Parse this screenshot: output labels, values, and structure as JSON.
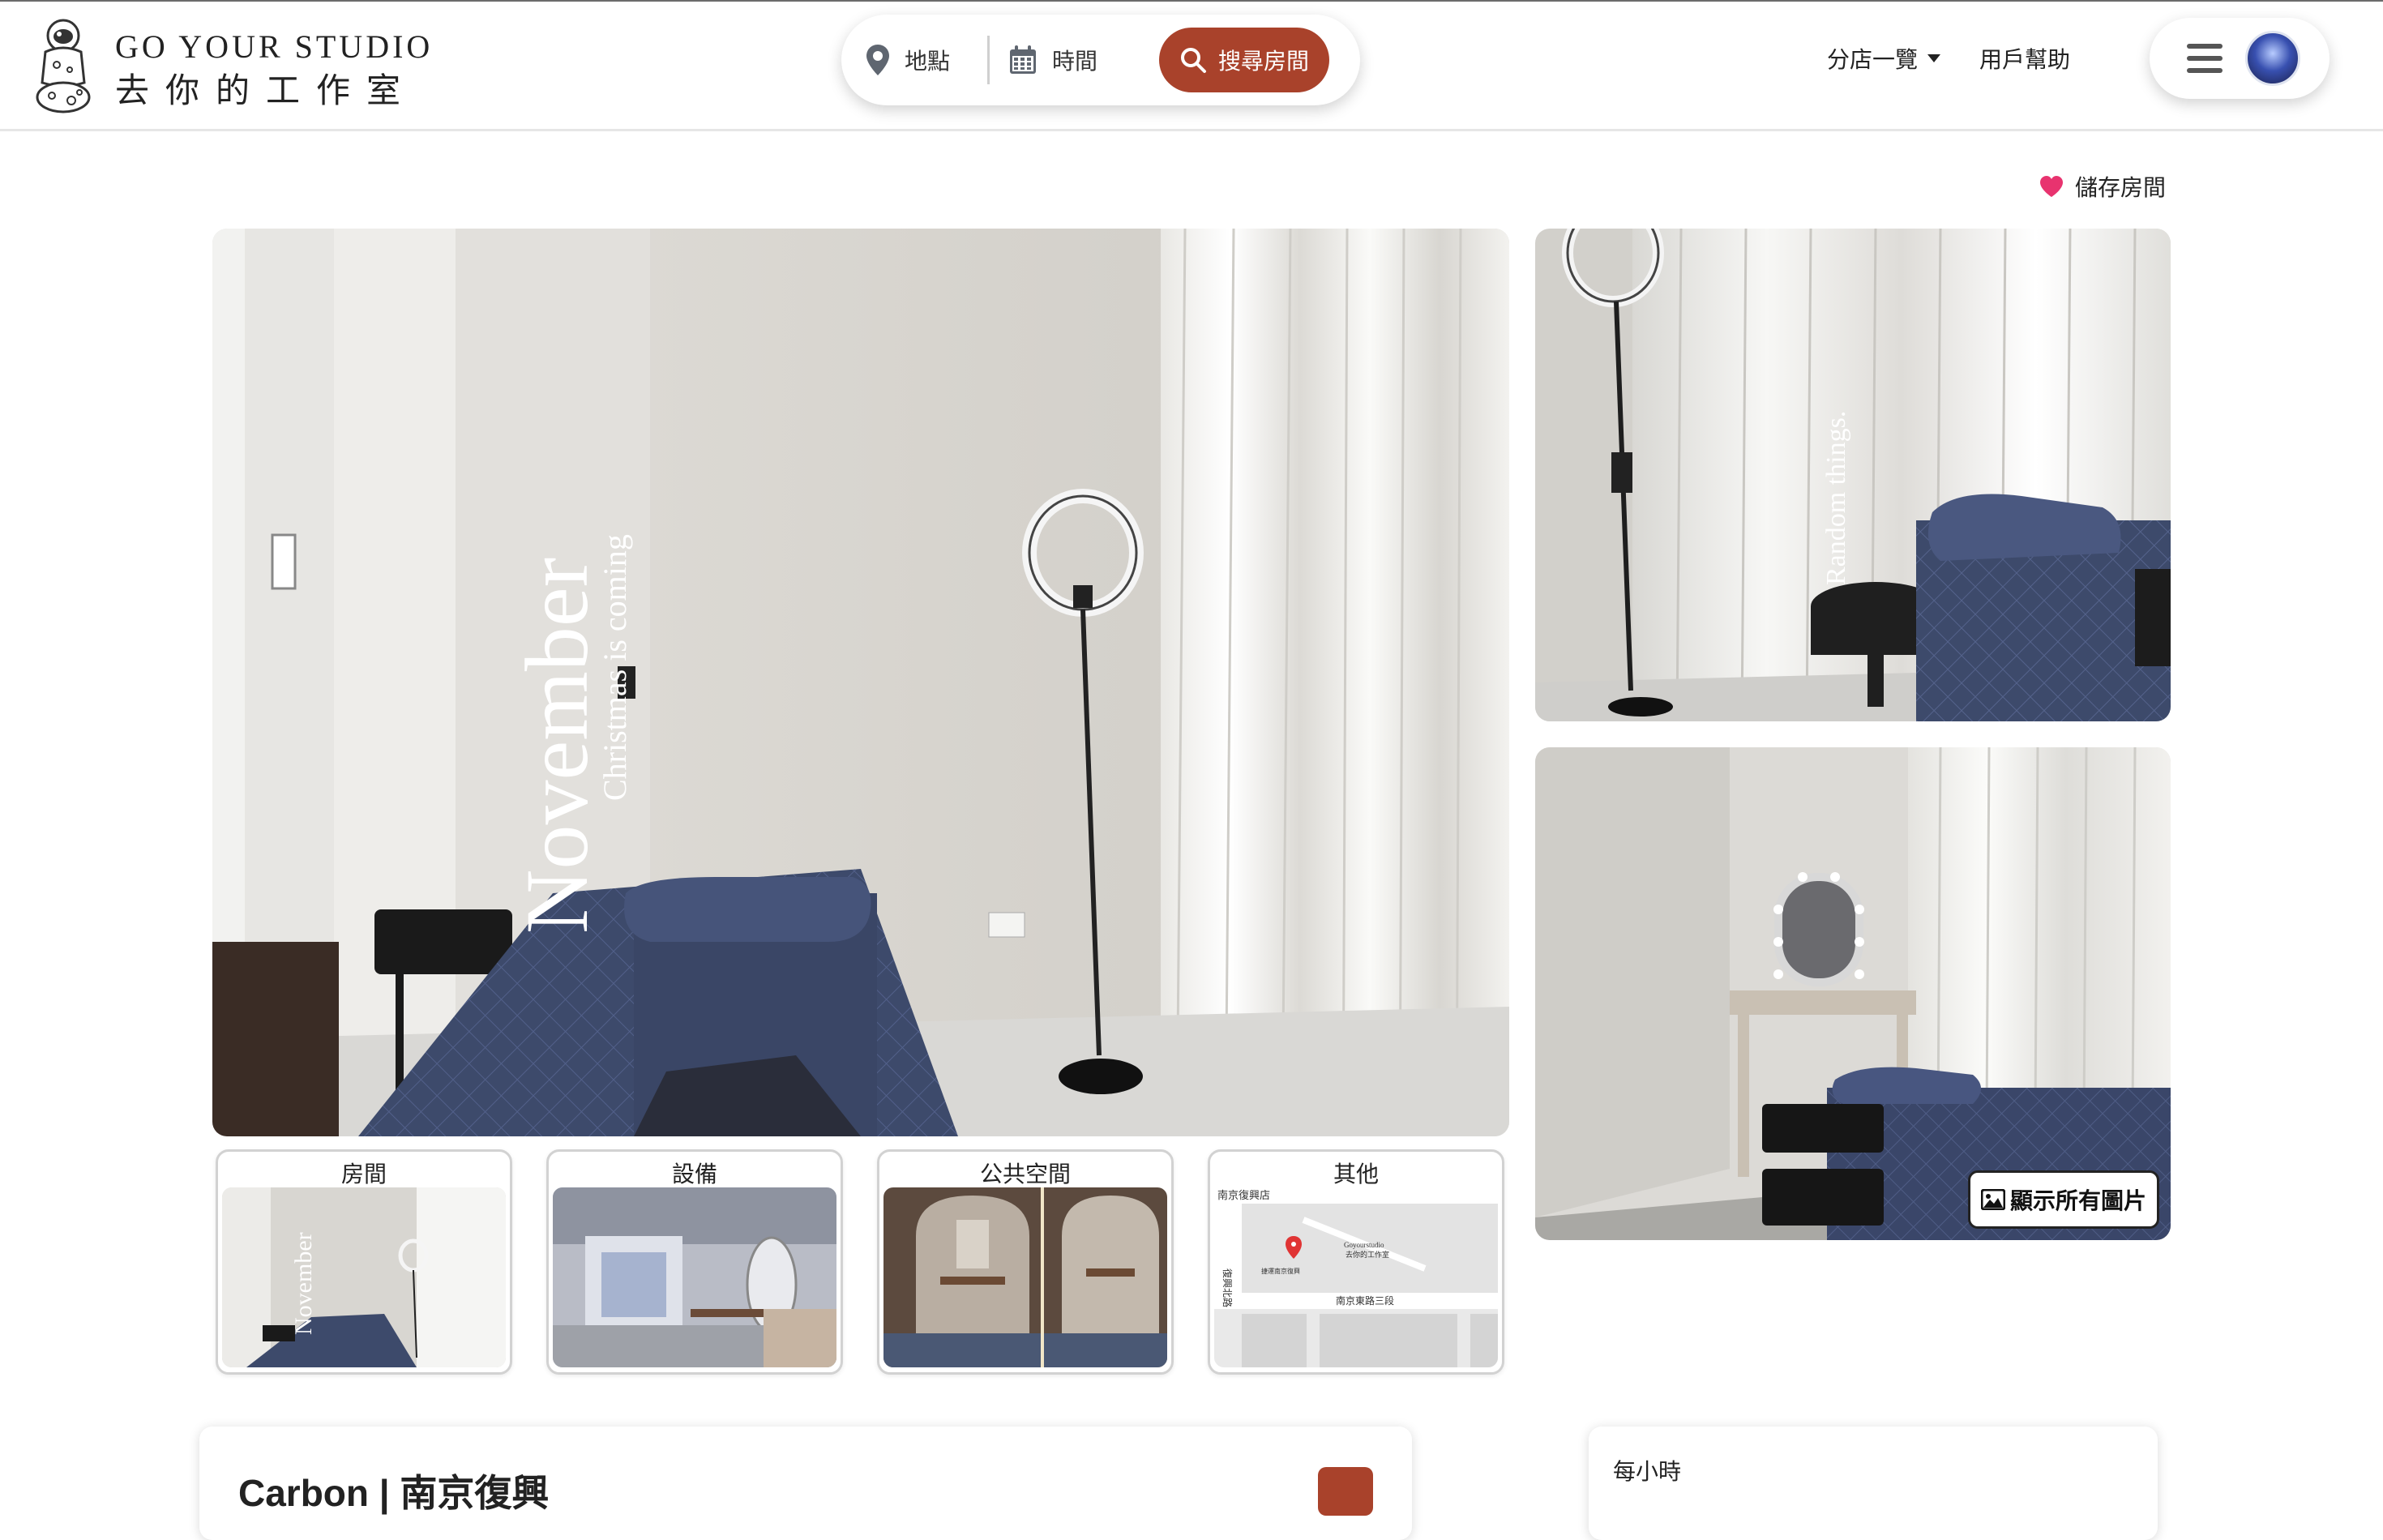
{
  "brand": {
    "name_en": "GO YOUR STUDIO",
    "name_zh": "去你的工作室",
    "logo_icon": "astronaut-logo"
  },
  "search": {
    "location_label": "地點",
    "location_icon": "map-pin-icon",
    "time_label": "時間",
    "time_icon": "calendar-icon",
    "button_label": "搜尋房間",
    "button_icon": "search-icon"
  },
  "nav": {
    "stores_label": "分店一覽",
    "help_label": "用戶幫助",
    "menu_icon": "hamburger-menu-icon"
  },
  "save_room": {
    "label": "儲存房間",
    "icon": "heart-icon"
  },
  "gallery": {
    "main_overlay_title": "November",
    "main_overlay_subtitle": "Christmas is coming",
    "side_top_overlay": "Random things.",
    "show_all_label": "顯示所有圖片",
    "show_all_icon": "image-icon"
  },
  "categories": [
    {
      "label": "房間",
      "thumb_text": "November"
    },
    {
      "label": "設備"
    },
    {
      "label": "公共空間"
    },
    {
      "label": "其他",
      "map_texts": {
        "store": "南京復興店",
        "brand_en": "Goyourstudio",
        "brand_zh": "去你的工作室",
        "street": "南京東路三段",
        "side_road": "復興北路",
        "metro": "捷運南京復興"
      }
    }
  ],
  "room": {
    "title": "Carbon | 南京復興"
  },
  "pricing": {
    "per_hour_label": "每小時"
  },
  "colors": {
    "accent": "#a9422b",
    "heart": "#e8336f",
    "bedding": "#3d4a6b"
  }
}
